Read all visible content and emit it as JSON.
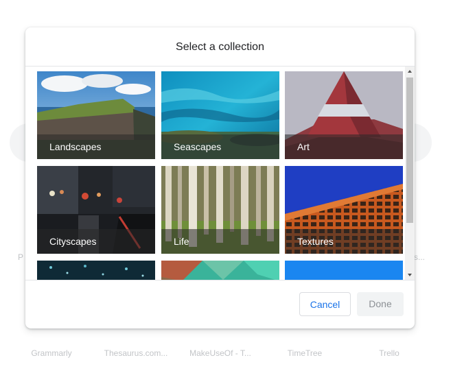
{
  "dialog": {
    "title": "Select a collection",
    "cancel_label": "Cancel",
    "done_label": "Done"
  },
  "collections": [
    {
      "label": "Landscapes"
    },
    {
      "label": "Seascapes"
    },
    {
      "label": "Art"
    },
    {
      "label": "Cityscapes"
    },
    {
      "label": "Life"
    },
    {
      "label": "Textures"
    },
    {
      "label": ""
    },
    {
      "label": ""
    },
    {
      "label": ""
    }
  ],
  "background": {
    "shortcuts": [
      "Grammarly",
      "Thesaurus.com...",
      "MakeUseOf - T...",
      "TimeTree",
      "Trello"
    ],
    "side_left": "P",
    "side_right": "s..."
  },
  "colors": {
    "accent": "#1a73e8",
    "caption_overlay": "rgba(40,40,40,0.55)"
  }
}
